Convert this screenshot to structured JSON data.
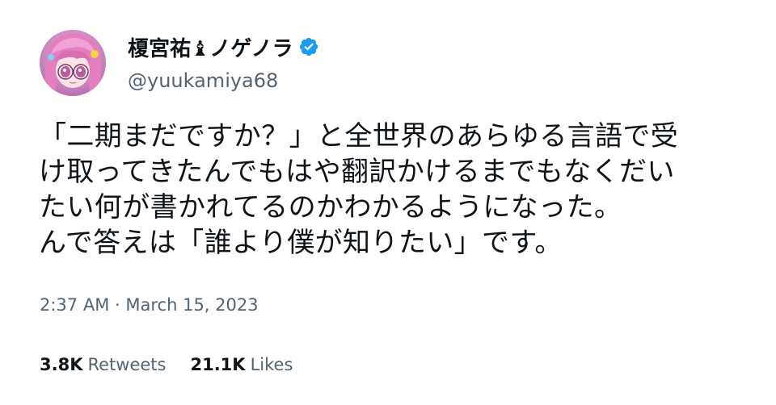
{
  "user": {
    "display_name": "榎宮祐♝ノゲノラ",
    "handle": "@yuukamiya68",
    "verified": true,
    "verified_color": "#1d9bf0"
  },
  "tweet": {
    "lines": [
      "「二期まだですか？」と全世界のあらゆる言語で受",
      "け取ってきたんでもはや翻訳かけるまでもなくだい",
      "たい何が書かれてるのかわかるようになった。",
      "んで答えは「誰より僕が知りたい」です。"
    ],
    "time": "2:37 AM",
    "separator": "·",
    "date": "March 15, 2023"
  },
  "stats": {
    "retweets_count": "3.8K",
    "retweets_label": "Retweets",
    "likes_count": "21.1K",
    "likes_label": "Likes"
  },
  "colors": {
    "text": "#0f1419",
    "secondary": "#536471",
    "background": "#ffffff"
  },
  "icons": {
    "avatar": "anime-avatar-image",
    "verified": "verified-badge-icon"
  }
}
